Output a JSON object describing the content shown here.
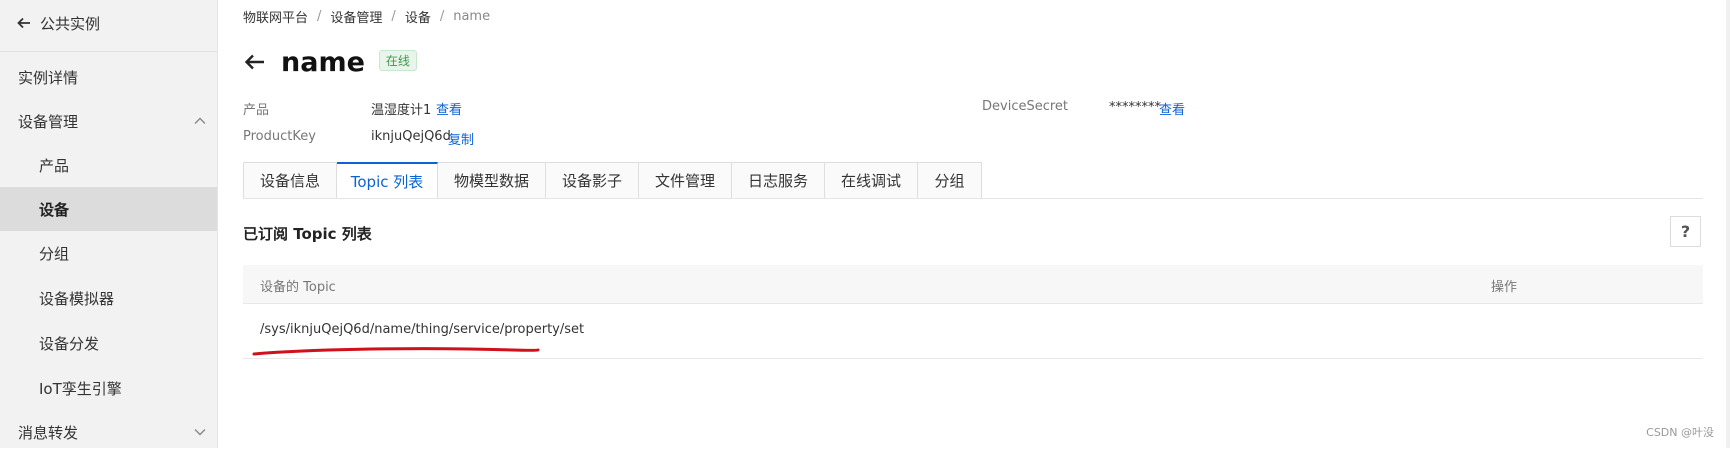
{
  "sidebar": {
    "back_label": "公共实例",
    "items": [
      {
        "label": "实例详情"
      },
      {
        "label": "设备管理"
      },
      {
        "label": "产品"
      },
      {
        "label": "设备"
      },
      {
        "label": "分组"
      },
      {
        "label": "设备模拟器"
      },
      {
        "label": "设备分发"
      },
      {
        "label": "IoT孪生引擎"
      },
      {
        "label": "消息转发"
      }
    ]
  },
  "breadcrumb": [
    "物联网平台",
    "设备管理",
    "设备",
    "name"
  ],
  "breadcrumb_sep": "/",
  "device": {
    "name": "name",
    "status": "在线",
    "product_label": "产品",
    "product_value": "温湿度计1",
    "product_link": "查看",
    "productkey_label": "ProductKey",
    "productkey_value": "iknjuQejQ6d",
    "productkey_link": "复制",
    "secret_label": "DeviceSecret",
    "secret_value": "********",
    "secret_link": "查看"
  },
  "tabs": [
    "设备信息",
    "Topic 列表",
    "物模型数据",
    "设备影子",
    "文件管理",
    "日志服务",
    "在线调试",
    "分组"
  ],
  "active_tab": "Topic 列表",
  "section": {
    "title": "已订阅 Topic 列表",
    "help": "?"
  },
  "table": {
    "columns": [
      "设备的 Topic",
      "操作"
    ],
    "rows": [
      {
        "topic": "/sys/iknjuQejQ6d/name/thing/service/property/set",
        "action": ""
      }
    ]
  },
  "colors": {
    "accent": "#0b63d6",
    "status_green": "#3f9a4a",
    "annotation_red": "#d0101a"
  },
  "watermark": "CSDN @叶没"
}
